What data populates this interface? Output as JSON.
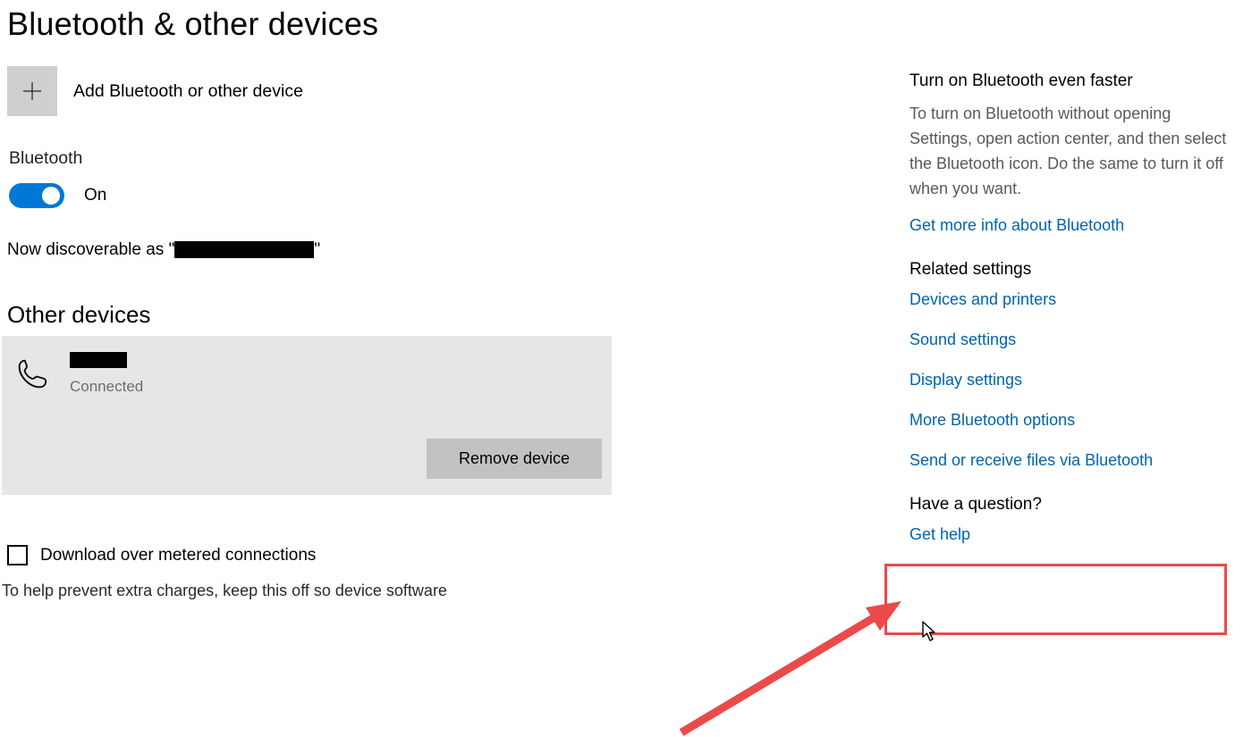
{
  "page": {
    "title": "Bluetooth & other devices"
  },
  "add": {
    "label": "Add Bluetooth or other device"
  },
  "bluetooth": {
    "label": "Bluetooth",
    "state_text": "On",
    "discoverable_prefix": "Now discoverable as \"",
    "discoverable_redacted_end": "\""
  },
  "other_devices": {
    "heading": "Other devices",
    "device": {
      "name_redacted": true,
      "status": "Connected"
    },
    "remove_label": "Remove device"
  },
  "metered": {
    "checkbox_label": "Download over metered connections",
    "help_text": "To help prevent extra charges, keep this off so device software"
  },
  "sidebar": {
    "tip": {
      "heading": "Turn on Bluetooth even faster",
      "body": "To turn on Bluetooth without opening Settings, open action center, and then select the Bluetooth icon. Do the same to turn it off when you want.",
      "link": "Get more info about Bluetooth"
    },
    "related": {
      "heading": "Related settings",
      "links": [
        "Devices and printers",
        "Sound settings",
        "Display settings",
        "More Bluetooth options",
        "Send or receive files via Bluetooth"
      ]
    },
    "question": {
      "heading": "Have a question?",
      "link": "Get help"
    }
  },
  "colors": {
    "accent": "#0078D7",
    "link": "#0063B1",
    "annotation": "#ea4a4a"
  }
}
